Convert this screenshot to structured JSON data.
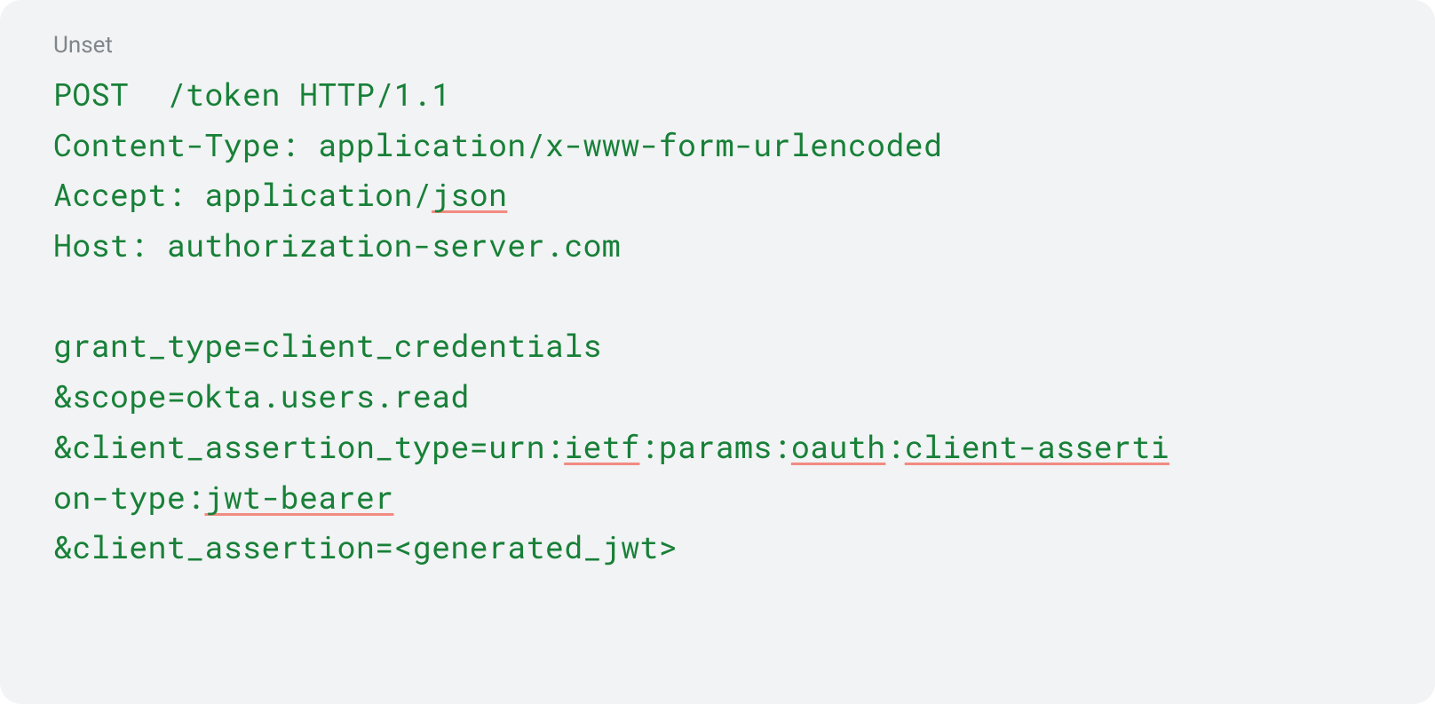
{
  "label": "Unset",
  "code": {
    "line1_a": "POST  /token HTTP/1.1",
    "line2_a": "Content-Type: application/x-www-form-urlencoded",
    "line3_a": "Accept: application/",
    "line3_b": "json",
    "line4_a": "Host: authorization-server.com",
    "blank": "",
    "line6_a": "grant_type=client_credentials",
    "line7_a": "&scope=okta.users.read",
    "line8_a": "&client_assertion_type=urn:",
    "line8_b": "ietf",
    "line8_c": ":params:",
    "line8_d": "oauth",
    "line8_e": ":",
    "line8_f": "client-asserti",
    "line9_a": "on-type:",
    "line9_b": "jwt-bearer",
    "line10_a": "&client_assertion=<generated_jwt>"
  }
}
